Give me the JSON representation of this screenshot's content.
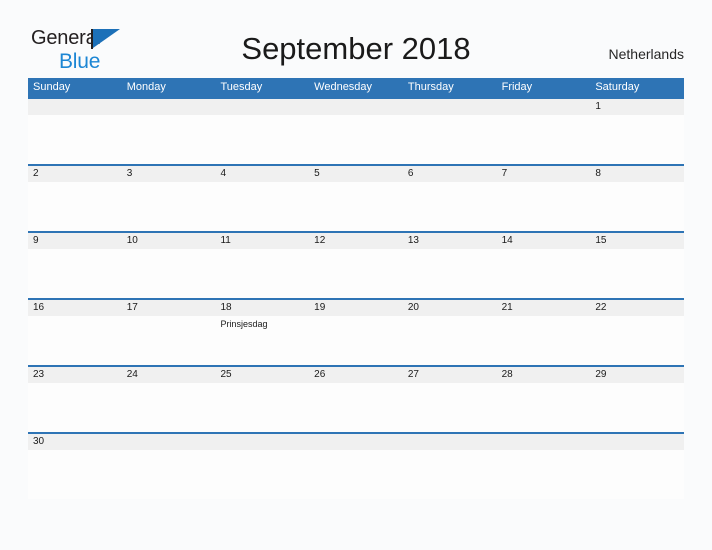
{
  "brand": {
    "name_part1": "General",
    "name_part2": "Blue",
    "flag_icon": "general-blue-flag-icon",
    "color_blue": "#1c70b8",
    "color_blue_light": "#1c86d4",
    "color_dark": "#231f20"
  },
  "header": {
    "title": "September 2018",
    "region": "Netherlands"
  },
  "theme": {
    "header_blue": "#2e74b5",
    "row_divider_blue": "#2e74b5",
    "number_band_gray": "#f0f0f0",
    "cell_white": "#fdfdfd",
    "page_background": "#fafbfc",
    "text_dark": "#1a1a1a"
  },
  "calendar": {
    "month": "September",
    "year": "2018",
    "weekday_headers": [
      "Sunday",
      "Monday",
      "Tuesday",
      "Wednesday",
      "Thursday",
      "Friday",
      "Saturday"
    ],
    "weeks": [
      {
        "days": [
          {
            "number": "",
            "events": []
          },
          {
            "number": "",
            "events": []
          },
          {
            "number": "",
            "events": []
          },
          {
            "number": "",
            "events": []
          },
          {
            "number": "",
            "events": []
          },
          {
            "number": "",
            "events": []
          },
          {
            "number": "1",
            "events": []
          }
        ]
      },
      {
        "days": [
          {
            "number": "2",
            "events": []
          },
          {
            "number": "3",
            "events": []
          },
          {
            "number": "4",
            "events": []
          },
          {
            "number": "5",
            "events": []
          },
          {
            "number": "6",
            "events": []
          },
          {
            "number": "7",
            "events": []
          },
          {
            "number": "8",
            "events": []
          }
        ]
      },
      {
        "days": [
          {
            "number": "9",
            "events": []
          },
          {
            "number": "10",
            "events": []
          },
          {
            "number": "11",
            "events": []
          },
          {
            "number": "12",
            "events": []
          },
          {
            "number": "13",
            "events": []
          },
          {
            "number": "14",
            "events": []
          },
          {
            "number": "15",
            "events": []
          }
        ]
      },
      {
        "days": [
          {
            "number": "16",
            "events": []
          },
          {
            "number": "17",
            "events": []
          },
          {
            "number": "18",
            "events": [
              "Prinsjesdag"
            ]
          },
          {
            "number": "19",
            "events": []
          },
          {
            "number": "20",
            "events": []
          },
          {
            "number": "21",
            "events": []
          },
          {
            "number": "22",
            "events": []
          }
        ]
      },
      {
        "days": [
          {
            "number": "23",
            "events": []
          },
          {
            "number": "24",
            "events": []
          },
          {
            "number": "25",
            "events": []
          },
          {
            "number": "26",
            "events": []
          },
          {
            "number": "27",
            "events": []
          },
          {
            "number": "28",
            "events": []
          },
          {
            "number": "29",
            "events": []
          }
        ]
      },
      {
        "days": [
          {
            "number": "30",
            "events": []
          },
          {
            "number": "",
            "events": []
          },
          {
            "number": "",
            "events": []
          },
          {
            "number": "",
            "events": []
          },
          {
            "number": "",
            "events": []
          },
          {
            "number": "",
            "events": []
          },
          {
            "number": "",
            "events": []
          }
        ]
      }
    ]
  }
}
